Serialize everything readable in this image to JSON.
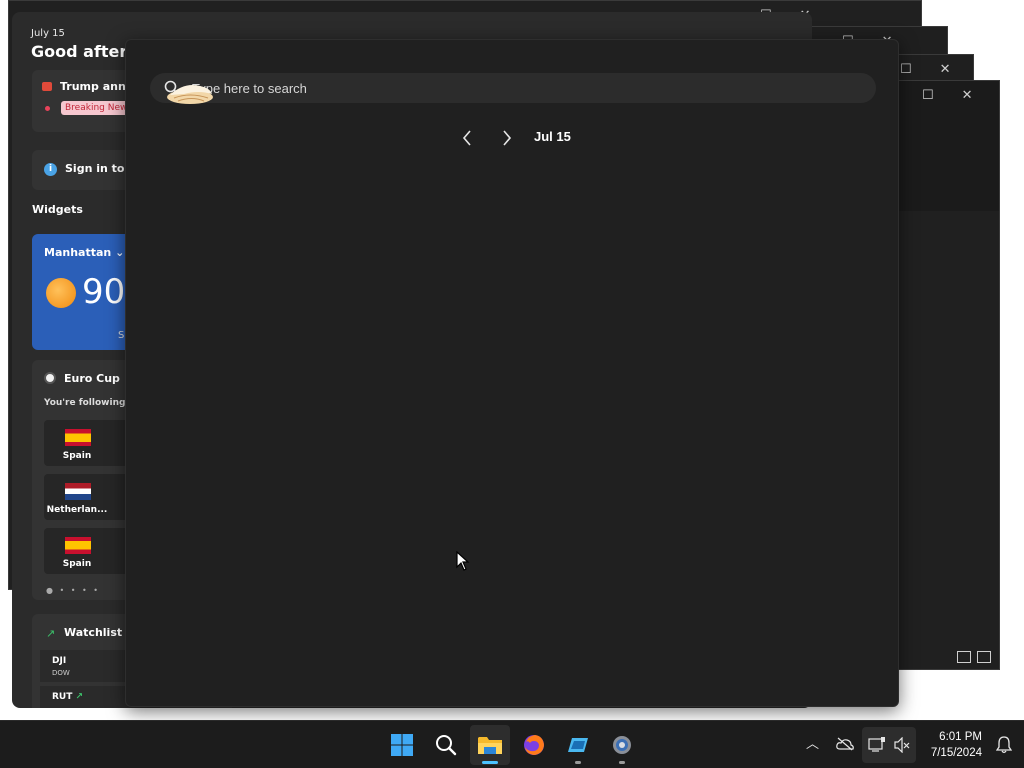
{
  "widgets": {
    "date": "July 15",
    "greeting": "Good afternoon",
    "news_headline": "Trump announces",
    "news_badge": "Breaking News",
    "signin_text": "Sign in to save",
    "section_title": "Widgets",
    "weather": {
      "city": "Manhattan",
      "temp": "90",
      "detail": "See"
    },
    "euro": {
      "title": "Euro Cup",
      "subtitle": "You're following these teams",
      "teams": [
        {
          "name": "Spain",
          "flag": "es"
        },
        {
          "name": "Netherlan...",
          "flag": "nl"
        },
        {
          "name": "Spain",
          "flag": "es"
        }
      ]
    },
    "watchlist": {
      "title": "Watchlist suggestions",
      "stocks": [
        {
          "symbol": "DJI",
          "sub": "DOW"
        },
        {
          "symbol": "RUT",
          "sub": ""
        }
      ]
    }
  },
  "search": {
    "placeholder": "Type here to search"
  },
  "calendar": {
    "date_label": "Jul 15"
  },
  "taskbar": {
    "apps": [
      "start-icon",
      "search-icon",
      "file-explorer-icon",
      "firefox-icon",
      "app-icon",
      "settings-icon"
    ],
    "clock_time": "6:01 PM",
    "clock_date": "7/15/2024"
  },
  "colors": {
    "accent": "#4cc2ff",
    "flyout_bg": "#202020",
    "weather_card": "#2b5fb8"
  }
}
